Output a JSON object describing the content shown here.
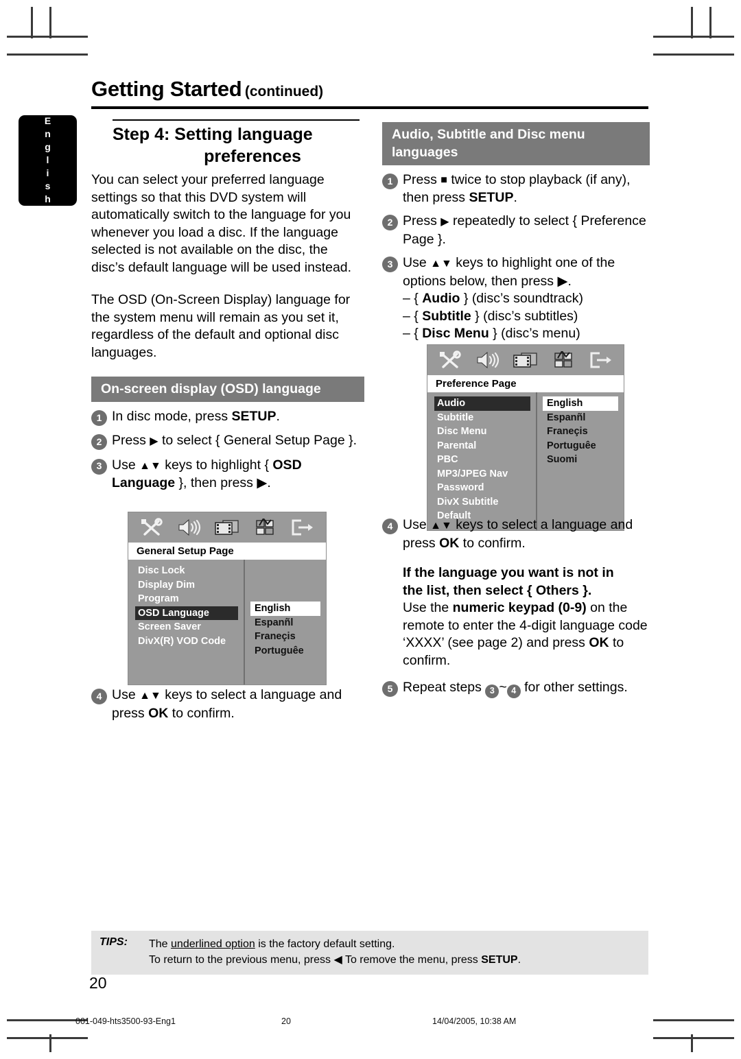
{
  "side_tab": {
    "label": "English"
  },
  "header": {
    "title": "Getting Started",
    "continued": "(continued)"
  },
  "left_column": {
    "step_heading_line1": "Step 4: Setting language",
    "step_heading_line2": "preferences",
    "paragraph1": "You can select your preferred language settings so that this DVD system will automatically switch to the language for you whenever you load a disc.  If the language selected is not available on the disc, the disc’s default language will be used instead.",
    "paragraph2": "The OSD (On-Screen Display) language for the system menu will remain as you set it, regardless of the default and optional disc languages.",
    "band_heading": "On-screen display (OSD) language",
    "steps": [
      {
        "num": "1",
        "text_before": "In disc mode, press ",
        "bold": "SETUP",
        "text_after": "."
      },
      {
        "num": "2",
        "text_before": "Press ",
        "arrow": "▶",
        "text_after": " to select { General Setup Page }."
      },
      {
        "num": "3",
        "text_before": "Use ",
        "arrows": "▲▼",
        "mid": " keys to highlight { ",
        "bold": "OSD Language",
        "text_after": " }, then press ▶."
      },
      {
        "num": "4",
        "text_before": "Use ",
        "arrows": "▲▼",
        "mid": " keys to select a language and press ",
        "bold": "OK",
        "text_after": " to confirm."
      }
    ]
  },
  "right_column": {
    "band_heading_line1": "Audio, Subtitle and Disc menu",
    "band_heading_line2": "languages",
    "steps": [
      {
        "num": "1",
        "text_before": "Press ",
        "glyph": "■",
        "mid": " twice to stop playback (if any), then press ",
        "bold": "SETUP",
        "text_after": "."
      },
      {
        "num": "2",
        "text_before": "Press ",
        "arrow": "▶",
        "text_after": " repeatedly to select { Preference Page }."
      },
      {
        "num": "3",
        "text_before": "Use ",
        "arrows": "▲▼",
        "text_after": " keys to highlight one of the options below, then press ▶."
      },
      {
        "num": "4",
        "text_before": "Use ",
        "arrows": "▲▼",
        "mid": " keys to select a language and press ",
        "bold": "OK",
        "text_after": " to confirm."
      },
      {
        "num": "5",
        "text_before": "Repeat steps ",
        "a": "3",
        "tilde": "~",
        "b": "4",
        "text_after": " for other settings."
      }
    ],
    "option_list": [
      {
        "dash": "–",
        "brace_open": "{",
        "bold": "Audio",
        "brace_close": "}",
        "desc": "(disc’s soundtrack)"
      },
      {
        "dash": "–",
        "brace_open": "{",
        "bold": "Subtitle",
        "brace_close": "}",
        "desc": "(disc’s subtitles)"
      },
      {
        "dash": "–",
        "brace_open": "{",
        "bold": "Disc Menu",
        "brace_close": "}",
        "desc": "(disc’s menu)"
      }
    ],
    "note": {
      "bold_line1": "If the language you want is not in",
      "bold_line2a": "the list, then select",
      "bold_line2b": "{ Others }.",
      "body_a": "Use the ",
      "body_bold1": "numeric keypad (0-9)",
      "body_b": " on the remote to enter the 4-digit language code ‘XXXX’ (see page 2) and press ",
      "body_bold2": "OK",
      "body_c": " to confirm."
    }
  },
  "osd_general": {
    "title": "General Setup Page",
    "icons": [
      "tools-icon",
      "speaker-icon",
      "film-icon",
      "preferences-icon",
      "exit-icon"
    ],
    "menu_items": [
      "Disc Lock",
      "Display Dim",
      "Program",
      "OSD Language",
      "Screen Saver",
      "DivX(R) VOD Code"
    ],
    "selected_item": "OSD Language",
    "options": [
      "English",
      "Espanñl",
      "Franeçis",
      "Portuguêe"
    ],
    "selected_option": "English"
  },
  "osd_preference": {
    "title": "Preference Page",
    "icons": [
      "tools-icon",
      "speaker-icon",
      "film-icon",
      "preferences-icon",
      "exit-icon"
    ],
    "menu_items": [
      "Audio",
      "Subtitle",
      "Disc Menu",
      "Parental",
      "PBC",
      "MP3/JPEG Nav",
      "Password",
      "DivX Subtitle",
      "Default"
    ],
    "selected_item": "Audio",
    "options": [
      "English",
      "Espanñl",
      "Franeçis",
      "Portuguêe",
      "Suomi"
    ],
    "selected_option": "English"
  },
  "tips": {
    "label": "TIPS:",
    "line1_a": "The ",
    "line1_underlined": "underlined option",
    "line1_b": " is the factory default setting.",
    "line2_a": "To return to the previous menu, press ",
    "line2_arrow": "◀",
    "line2_b": "  To remove the menu, press ",
    "line2_bold": "SETUP",
    "line2_c": "."
  },
  "page_number": "20",
  "footer": {
    "file": "001-049-hts3500-93-Eng1",
    "page": "20",
    "timestamp": "14/04/2005, 10:38 AM"
  },
  "colors": {
    "band_grey": "#7a7a7a",
    "osd_grey": "#9a9a9a",
    "osd_selected": "#2b2b2b",
    "tips_grey": "#e3e3e3",
    "bullet_grey": "#6e6e6e"
  }
}
